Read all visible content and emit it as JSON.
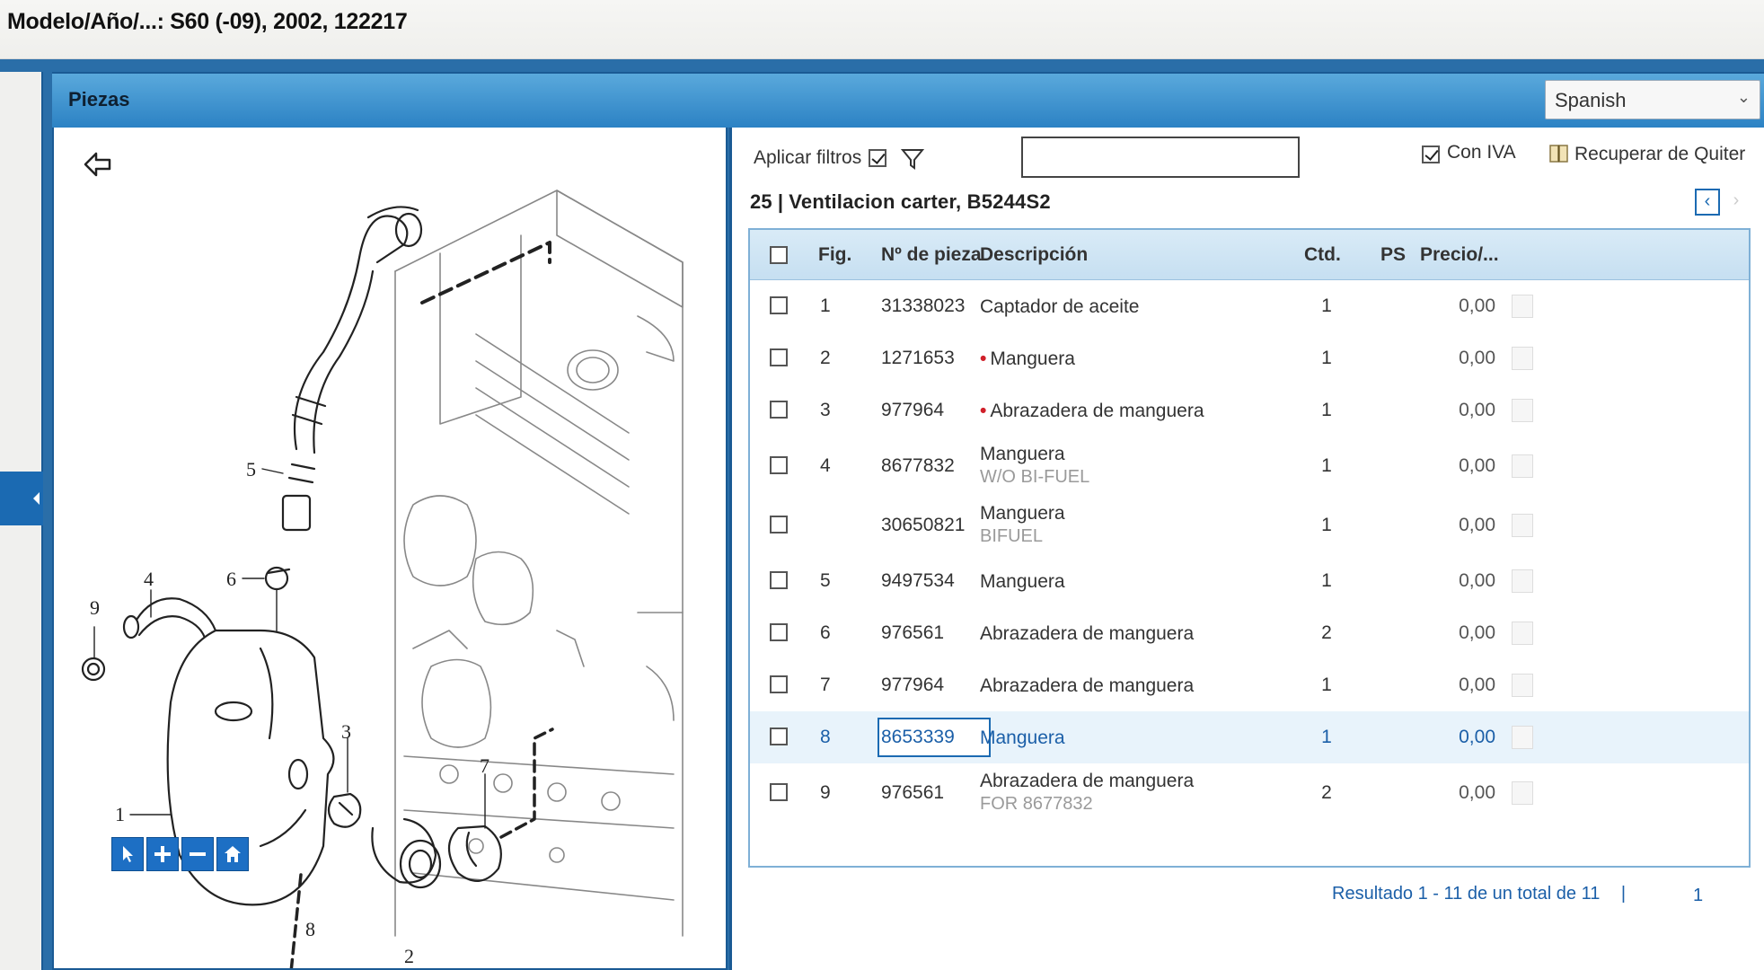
{
  "model_bar": {
    "text": "Modelo/Año/...: S60 (-09), 2002, 122217"
  },
  "header": {
    "title": "Piezas",
    "language": "Spanish"
  },
  "diagram": {
    "callouts": [
      "5",
      "4",
      "9",
      "6",
      "3",
      "7",
      "1",
      "8",
      "2"
    ]
  },
  "filters": {
    "apply_label": "Aplicar filtros",
    "apply_checked": true,
    "search_placeholder": "",
    "con_iva_label": "Con IVA",
    "con_iva_checked": true,
    "quiter_label": "Recuperar de Quiter"
  },
  "section": {
    "number": "25",
    "separator": "|",
    "name": "Ventilacion carter, B5244S2"
  },
  "table": {
    "headers": {
      "fig": "Fig.",
      "part_no": "Nº de pieza",
      "description": "Descripción",
      "qty": "Ctd.",
      "ps": "PS",
      "price": "Precio/..."
    },
    "rows": [
      {
        "fig": "1",
        "part_no": "31338023",
        "description": "Captador de aceite",
        "sub": "",
        "red_dot": false,
        "qty": "1",
        "price": "0,00",
        "selected": false
      },
      {
        "fig": "2",
        "part_no": "1271653",
        "description": "Manguera",
        "sub": "",
        "red_dot": true,
        "qty": "1",
        "price": "0,00",
        "selected": false
      },
      {
        "fig": "3",
        "part_no": "977964",
        "description": "Abrazadera de manguera",
        "sub": "",
        "red_dot": true,
        "qty": "1",
        "price": "0,00",
        "selected": false
      },
      {
        "fig": "4",
        "part_no": "8677832",
        "description": "Manguera",
        "sub": "W/O BI-FUEL",
        "red_dot": false,
        "qty": "1",
        "price": "0,00",
        "selected": false
      },
      {
        "fig": "",
        "part_no": "30650821",
        "description": "Manguera",
        "sub": "BIFUEL",
        "red_dot": false,
        "qty": "1",
        "price": "0,00",
        "selected": false
      },
      {
        "fig": "5",
        "part_no": "9497534",
        "description": "Manguera",
        "sub": "",
        "red_dot": false,
        "qty": "1",
        "price": "0,00",
        "selected": false
      },
      {
        "fig": "6",
        "part_no": "976561",
        "description": "Abrazadera de manguera",
        "sub": "",
        "red_dot": false,
        "qty": "2",
        "price": "0,00",
        "selected": false
      },
      {
        "fig": "7",
        "part_no": "977964",
        "description": "Abrazadera de manguera",
        "sub": "",
        "red_dot": false,
        "qty": "1",
        "price": "0,00",
        "selected": false
      },
      {
        "fig": "8",
        "part_no": "8653339",
        "description": "Manguera",
        "sub": "",
        "red_dot": false,
        "qty": "1",
        "price": "0,00",
        "selected": true
      },
      {
        "fig": "9",
        "part_no": "976561",
        "description": "Abrazadera de manguera",
        "sub": "FOR 8677832",
        "red_dot": false,
        "qty": "2",
        "price": "0,00",
        "selected": false
      }
    ]
  },
  "footer": {
    "result": "Resultado 1 - 11 de un total de 11",
    "separator": "|",
    "page": "1"
  },
  "colors": {
    "accent": "#1b6ab2",
    "header_blue": "#2c82c4",
    "red_marker": "#d0202a"
  }
}
